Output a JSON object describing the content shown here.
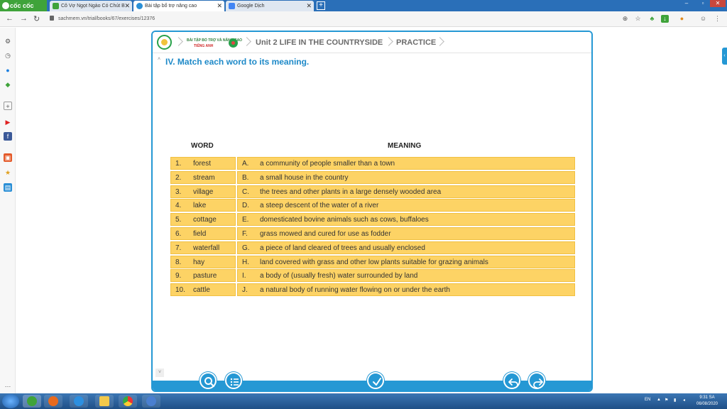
{
  "browser": {
    "brand": "cốc cốc",
    "tabs": [
      {
        "title": "Cô Vợ Ngọt Ngào Có Chút B",
        "active": false
      },
      {
        "title": "Bài tập bổ trợ nâng cao",
        "active": true
      },
      {
        "title": "Google Dịch",
        "active": false
      }
    ],
    "new_tab_label": "+",
    "url": "sachmem.vn/trial/books/67/exercises/12376"
  },
  "breadcrumb": {
    "logo_line1": "BÀI TẬP BỔ TRỢ VÀ NÂNG CAO",
    "logo_line2": "TIẾNG ANH",
    "unit": "Unit 2 LIFE IN THE COUNTRYSIDE",
    "section": "PRACTICE"
  },
  "exercise": {
    "heading": "IV. Match each word to its meaning.",
    "col_word": "WORD",
    "col_meaning": "MEANING",
    "rows": [
      {
        "num": "1.",
        "word": "forest",
        "letter": "A.",
        "meaning": "a community of people smaller than a town"
      },
      {
        "num": "2.",
        "word": "stream",
        "letter": "B.",
        "meaning": "a small house in the country"
      },
      {
        "num": "3.",
        "word": "village",
        "letter": "C.",
        "meaning": "the trees and other plants in a large densely wooded area"
      },
      {
        "num": "4.",
        "word": "lake",
        "letter": "D.",
        "meaning": "a steep descent of the water of a river"
      },
      {
        "num": "5.",
        "word": "cottage",
        "letter": "E.",
        "meaning": "domesticated bovine animals such as cows, buffaloes"
      },
      {
        "num": "6.",
        "word": "field",
        "letter": "F.",
        "meaning": "grass mowed and cured for use as fodder"
      },
      {
        "num": "7.",
        "word": "waterfall",
        "letter": "G.",
        "meaning": "a piece of land cleared of trees and usually enclosed"
      },
      {
        "num": "8.",
        "word": "hay",
        "letter": "H.",
        "meaning": "land covered with grass and other low plants suitable for grazing animals"
      },
      {
        "num": "9.",
        "word": "pasture",
        "letter": "I.",
        "meaning": "a body of (usually fresh) water surrounded by land"
      },
      {
        "num": "10.",
        "word": "cattle",
        "letter": "J.",
        "meaning": "a natural body of running water flowing on or under the earth"
      }
    ]
  },
  "taskbar": {
    "lang": "EN",
    "time": "9:31 SA",
    "date": "06/08/2020"
  },
  "colors": {
    "accent": "#2598d4",
    "cell": "#fdd365",
    "heading": "#1d89c8"
  }
}
